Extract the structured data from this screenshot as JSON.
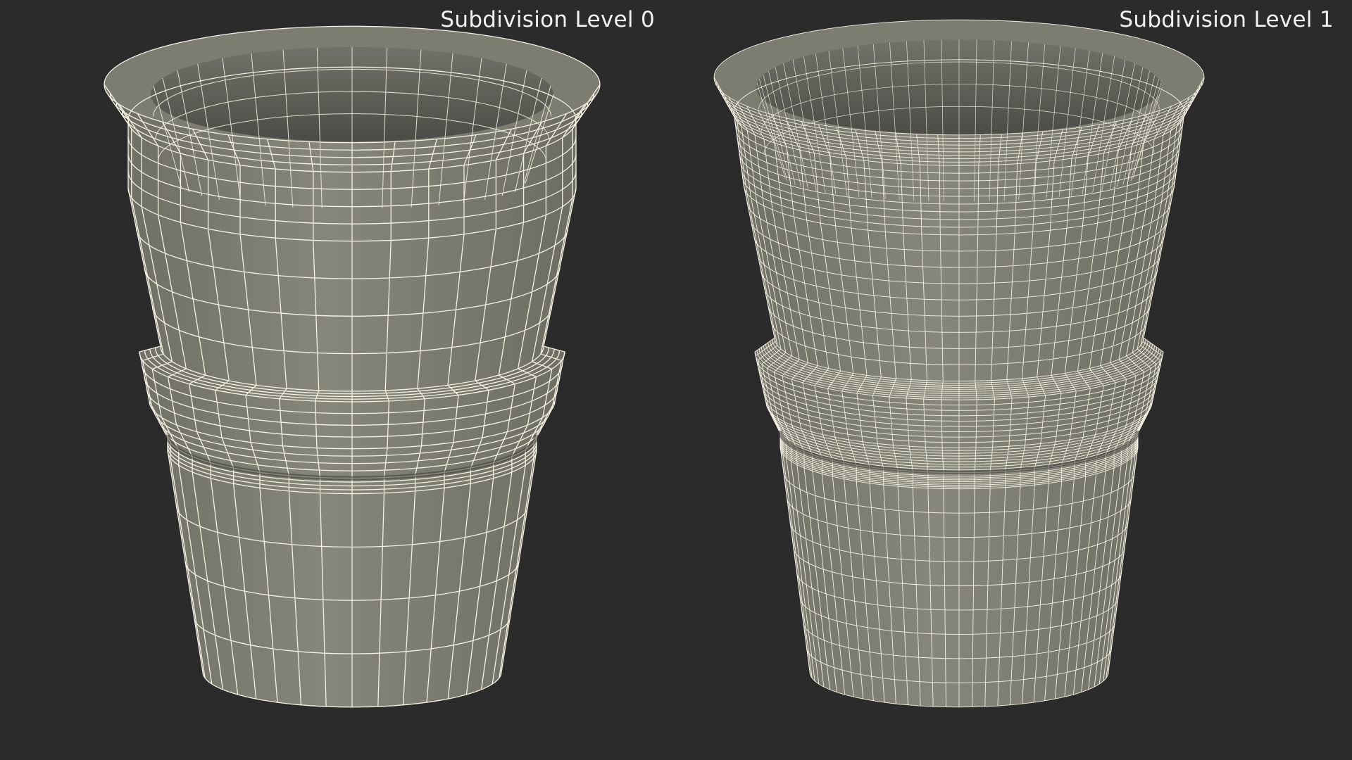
{
  "labels": {
    "level0": "Subdivision Level 0",
    "level1": "Subdivision Level 1"
  },
  "colors": {
    "background": "#2b2b2b",
    "label": "#f2f2f2",
    "mesh_surface": "#7a7a6e",
    "mesh_inner": "#5a5a52",
    "wire": "#f4f1e2"
  },
  "meshes": [
    {
      "name": "level0",
      "subdivision_level": 0
    },
    {
      "name": "level1",
      "subdivision_level": 1
    }
  ]
}
